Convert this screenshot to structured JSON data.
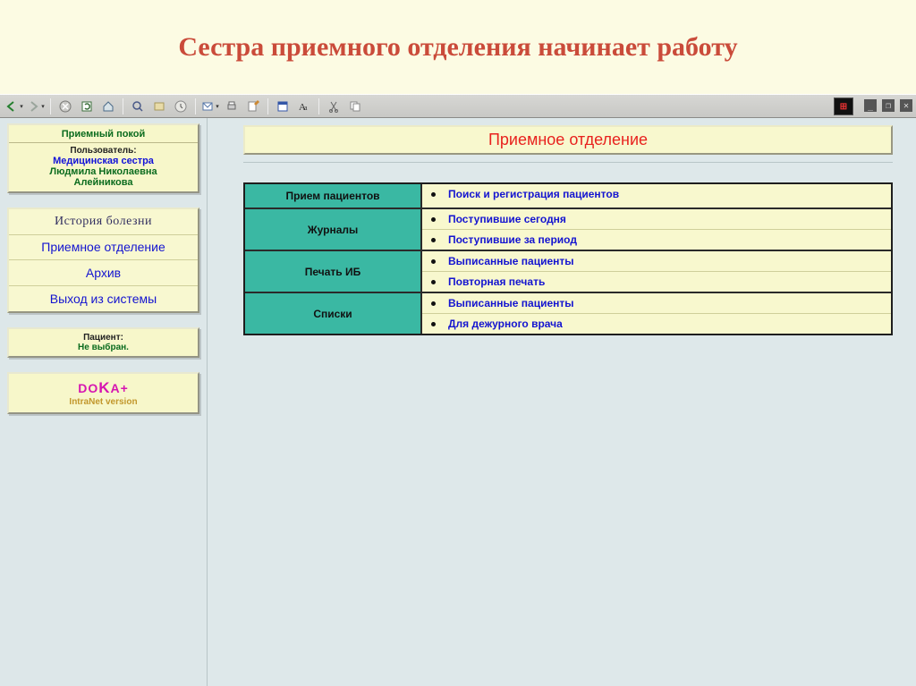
{
  "slide_title": "Сестра приемного отделения начинает работу",
  "toolbar": {
    "icons": [
      "back",
      "forward",
      "stop",
      "refresh",
      "home",
      "search",
      "favorites",
      "history",
      "mail",
      "print",
      "edit",
      "media",
      "find",
      "cut",
      "copy"
    ]
  },
  "user_panel": {
    "title": "Приемный покой",
    "user_label": "Пользователь:",
    "role": "Медицинская сестра",
    "name_line1": "Людмила Николаевна",
    "name_line2": "Алейникова"
  },
  "nav": {
    "items": [
      "История болезни",
      "Приемное отделение",
      "Архив",
      "Выход из системы"
    ]
  },
  "patient_panel": {
    "label": "Пациент:",
    "value": "Не выбран."
  },
  "brand_panel": {
    "logo_pre": "DO",
    "logo_big": "K",
    "logo_post": "A+",
    "sub": "IntraNet version"
  },
  "content": {
    "dept_title": "Приемное отделение",
    "rows": [
      {
        "category": "Прием пациентов",
        "links": [
          "Поиск и регистрация пациентов"
        ]
      },
      {
        "category": "Журналы",
        "links": [
          "Поступившие сегодня",
          "Поступившие за период"
        ]
      },
      {
        "category": "Печать ИБ",
        "links": [
          "Выписанные пациенты",
          "Повторная печать"
        ]
      },
      {
        "category": "Списки",
        "links": [
          "Выписанные пациенты",
          "Для дежурного врача"
        ]
      }
    ]
  }
}
